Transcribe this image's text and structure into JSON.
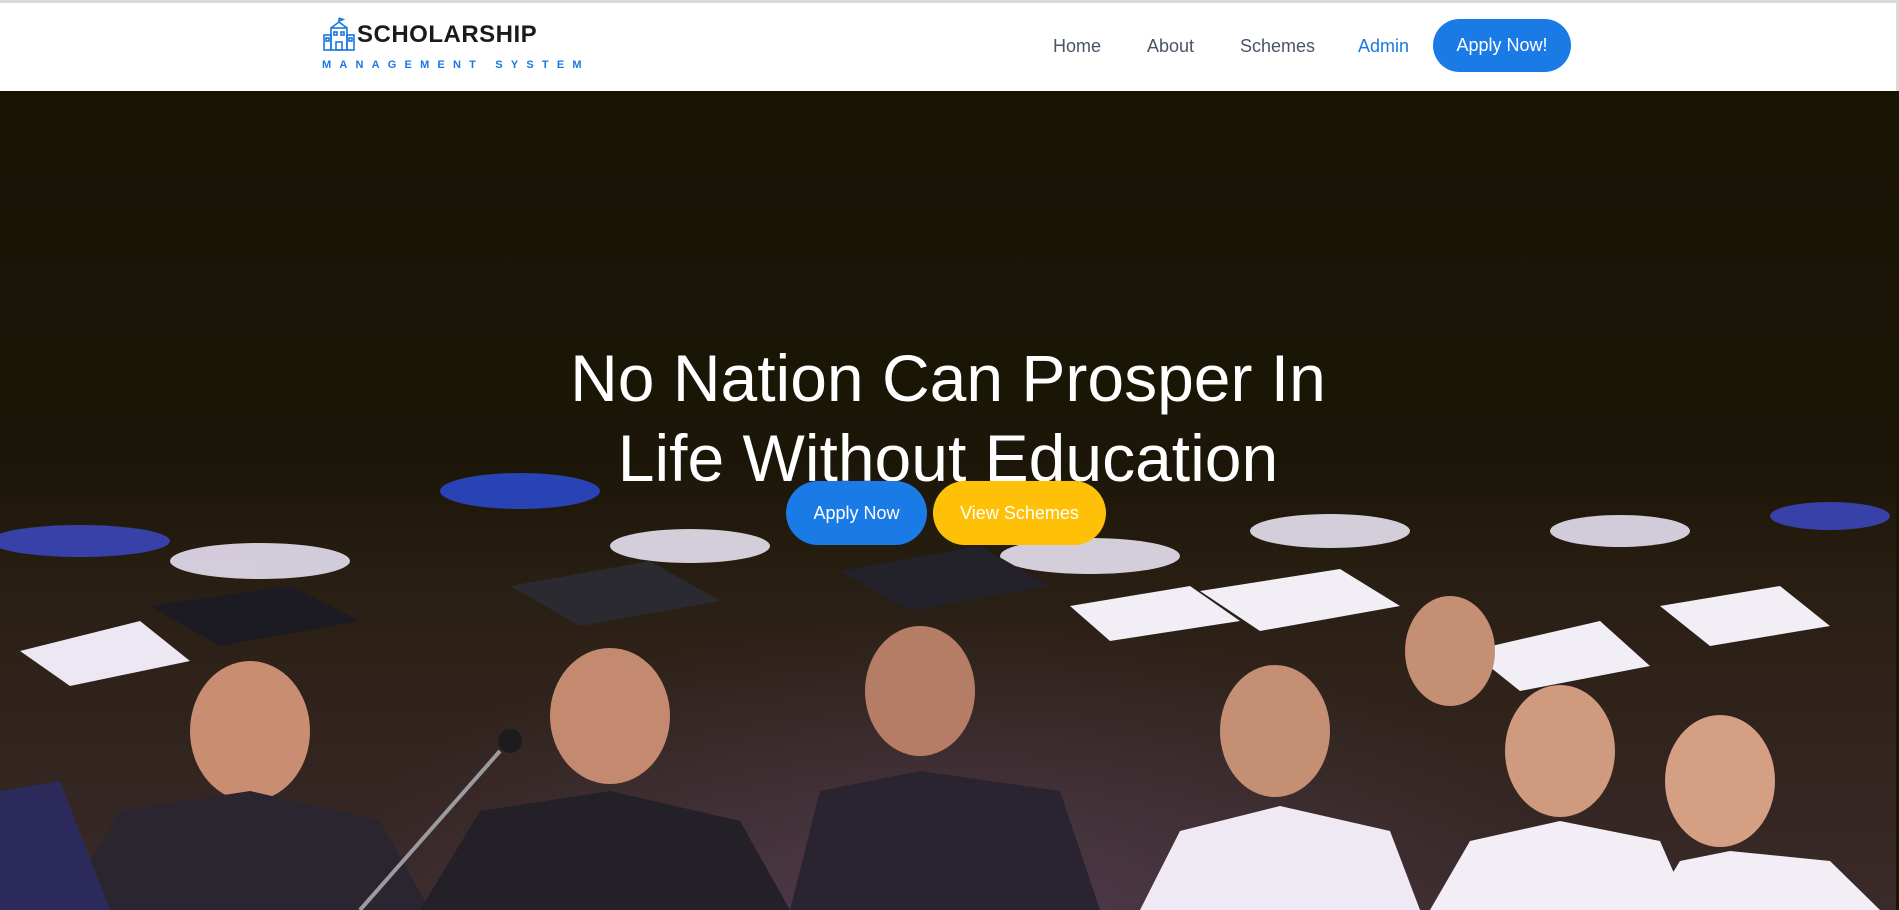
{
  "brand": {
    "title": "SCHOLARSHIP",
    "subtitle": "MANAGEMENT SYSTEM",
    "icon": "school-building-icon"
  },
  "nav": {
    "items": [
      {
        "label": "Home"
      },
      {
        "label": "About"
      },
      {
        "label": "Schemes"
      },
      {
        "label": "Admin",
        "active": true
      }
    ],
    "cta_label": "Apply Now!"
  },
  "hero": {
    "headline_line1": "No Nation Can Prosper In",
    "headline_line2": "Life Without Education",
    "primary_button": "Apply Now",
    "secondary_button": "View Schemes",
    "background": "graduation-crowd-photo"
  },
  "colors": {
    "accent_blue": "#1a7be6",
    "accent_yellow": "#ffc107",
    "nav_text": "#4a5466",
    "hero_bg": "#1a1605"
  }
}
